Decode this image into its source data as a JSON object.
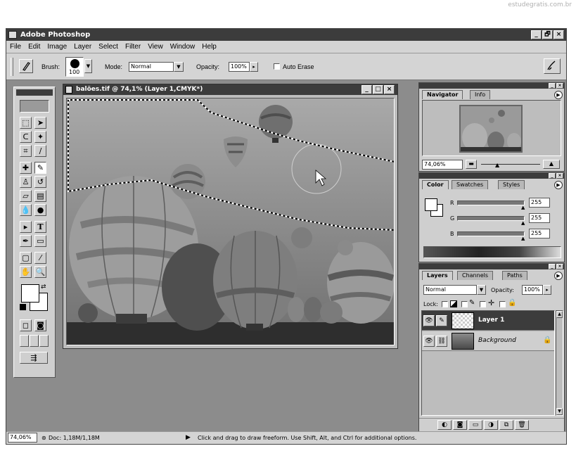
{
  "watermark": "estudegratis.com.br",
  "app": {
    "title": "Adobe Photoshop",
    "window_buttons": {
      "minimize": "_",
      "restore": "🗗",
      "close": "×"
    }
  },
  "menu": [
    "File",
    "Edit",
    "Image",
    "Layer",
    "Select",
    "Filter",
    "View",
    "Window",
    "Help"
  ],
  "options": {
    "brush_label": "Brush:",
    "brush_size": "100",
    "mode_label": "Mode:",
    "mode_value": "Normal",
    "opacity_label": "Opacity:",
    "opacity_value": "100%",
    "auto_erase_label": "Auto Erase"
  },
  "document": {
    "title": "balões.tif @ 74,1% (Layer 1,CMYK*)"
  },
  "navigator": {
    "tabs": [
      "Navigator",
      "Info"
    ],
    "zoom": "74,06%"
  },
  "color": {
    "tabs": [
      "Color",
      "Swatches",
      "Styles"
    ],
    "channels": [
      {
        "label": "R",
        "value": "255"
      },
      {
        "label": "G",
        "value": "255"
      },
      {
        "label": "B",
        "value": "255"
      }
    ]
  },
  "layers": {
    "tabs": [
      "Layers",
      "Channels",
      "Paths"
    ],
    "blend_mode": "Normal",
    "opacity_label": "Opacity:",
    "opacity_value": "100%",
    "lock_label": "Lock:",
    "items": [
      {
        "name": "Layer 1",
        "selected": true
      },
      {
        "name": "Background",
        "selected": false
      }
    ]
  },
  "status": {
    "zoom": "74,06%",
    "doc": "Doc: 1,18M/1,18M",
    "hint": "Click and drag to draw freeform. Use Shift, Alt, and Ctrl for additional options."
  },
  "colors": {
    "title_bar": "#3c3c3c",
    "workspace": "#8c8c8c",
    "panel": "#cfcfcf"
  }
}
